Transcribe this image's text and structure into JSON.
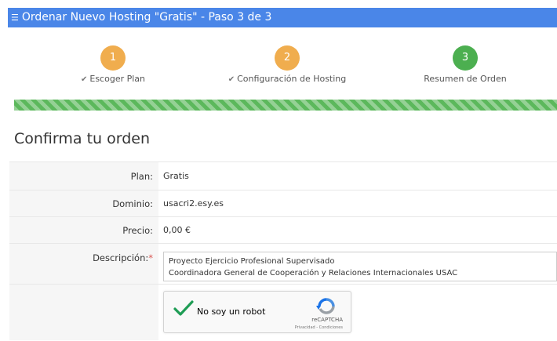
{
  "header": {
    "menu_icon": "hamburger-icon",
    "title": "Ordenar Nuevo Hosting \"Gratis\" - Paso 3 de 3"
  },
  "steps": [
    {
      "number": "1",
      "label": "Escoger Plan",
      "completed_icon": "check-icon",
      "color": "#f0ad4e"
    },
    {
      "number": "2",
      "label": "Configuración de Hosting",
      "completed_icon": "check-icon",
      "color": "#f0ad4e"
    },
    {
      "number": "3",
      "label": "Resumen de Orden",
      "color": "#4caf50"
    }
  ],
  "progress": {
    "percent": 100,
    "color": "#5cb85c"
  },
  "confirm": {
    "heading": "Confirma tu orden",
    "rows": [
      {
        "label": "Plan:",
        "value": "Gratis"
      },
      {
        "label": "Dominio:",
        "value": "usacri2.esy.es"
      },
      {
        "label": "Precio:",
        "value": "0,00 €"
      }
    ],
    "description": {
      "label": "Descripción:",
      "required_mark": "*",
      "line1": "Proyecto Ejercicio Profesional Supervisado",
      "line2": "Coordinadora General de Cooperación y Relaciones Internacionales USAC"
    },
    "captcha": {
      "text": "No soy un robot",
      "brand": "reCAPTCHA",
      "terms": "Privacidad - Condiciones",
      "checked": true
    }
  },
  "colors": {
    "header_bg": "#4a86e8",
    "required": "#d9534f"
  }
}
